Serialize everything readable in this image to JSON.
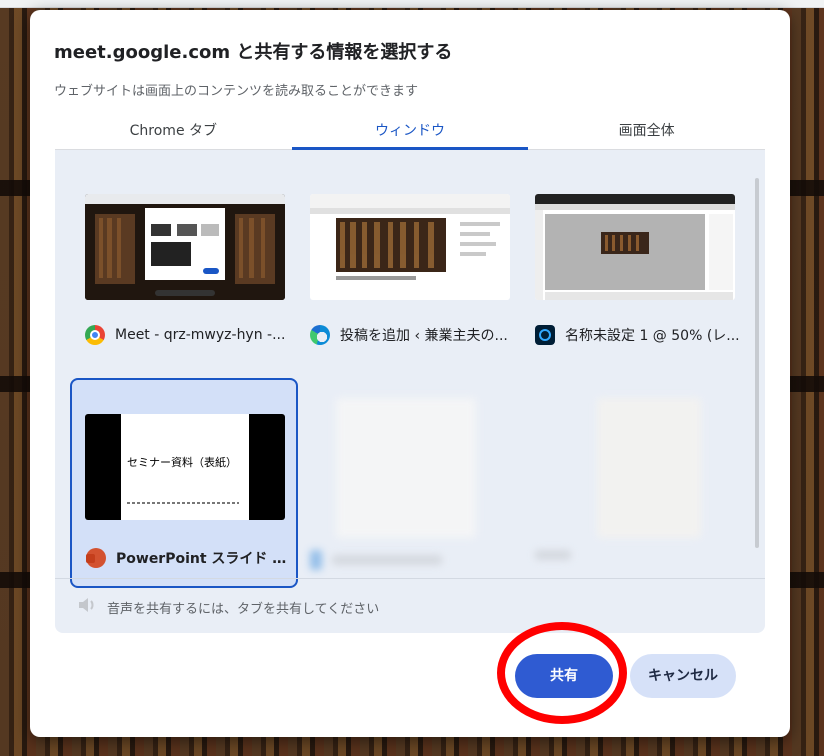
{
  "dialog": {
    "title": "meet.google.com と共有する情報を選択する",
    "subtitle": "ウェブサイトは画面上のコンテンツを読み取ることができます"
  },
  "tabs": [
    {
      "label": "Chrome タブ",
      "active": false
    },
    {
      "label": "ウィンドウ",
      "active": true
    },
    {
      "label": "画面全体",
      "active": false
    }
  ],
  "windows": [
    {
      "label": "Meet - qrz-mwyz-hyn -...",
      "icon": "chrome-icon"
    },
    {
      "label": "投稿を追加 ‹ 兼業主夫の...",
      "icon": "edge-icon"
    },
    {
      "label": "名称未設定 1 @ 50% (レ...",
      "icon": "photoshop-icon"
    },
    {
      "label": "PowerPoint スライド ショ...",
      "icon": "powerpoint-icon",
      "selected": true,
      "thumb_text": "セミナー資料（表紙）"
    },
    {
      "label": "",
      "icon": "blurred-icon",
      "blurred": true
    },
    {
      "label": "",
      "icon": "blurred-icon",
      "blurred": true
    }
  ],
  "audio_note": "音声を共有するには、タブを共有してください",
  "buttons": {
    "share": "共有",
    "cancel": "キャンセル"
  },
  "colors": {
    "accent": "#1a56c5",
    "share_button": "#2f5bd2",
    "annotation": "#ff0000"
  }
}
